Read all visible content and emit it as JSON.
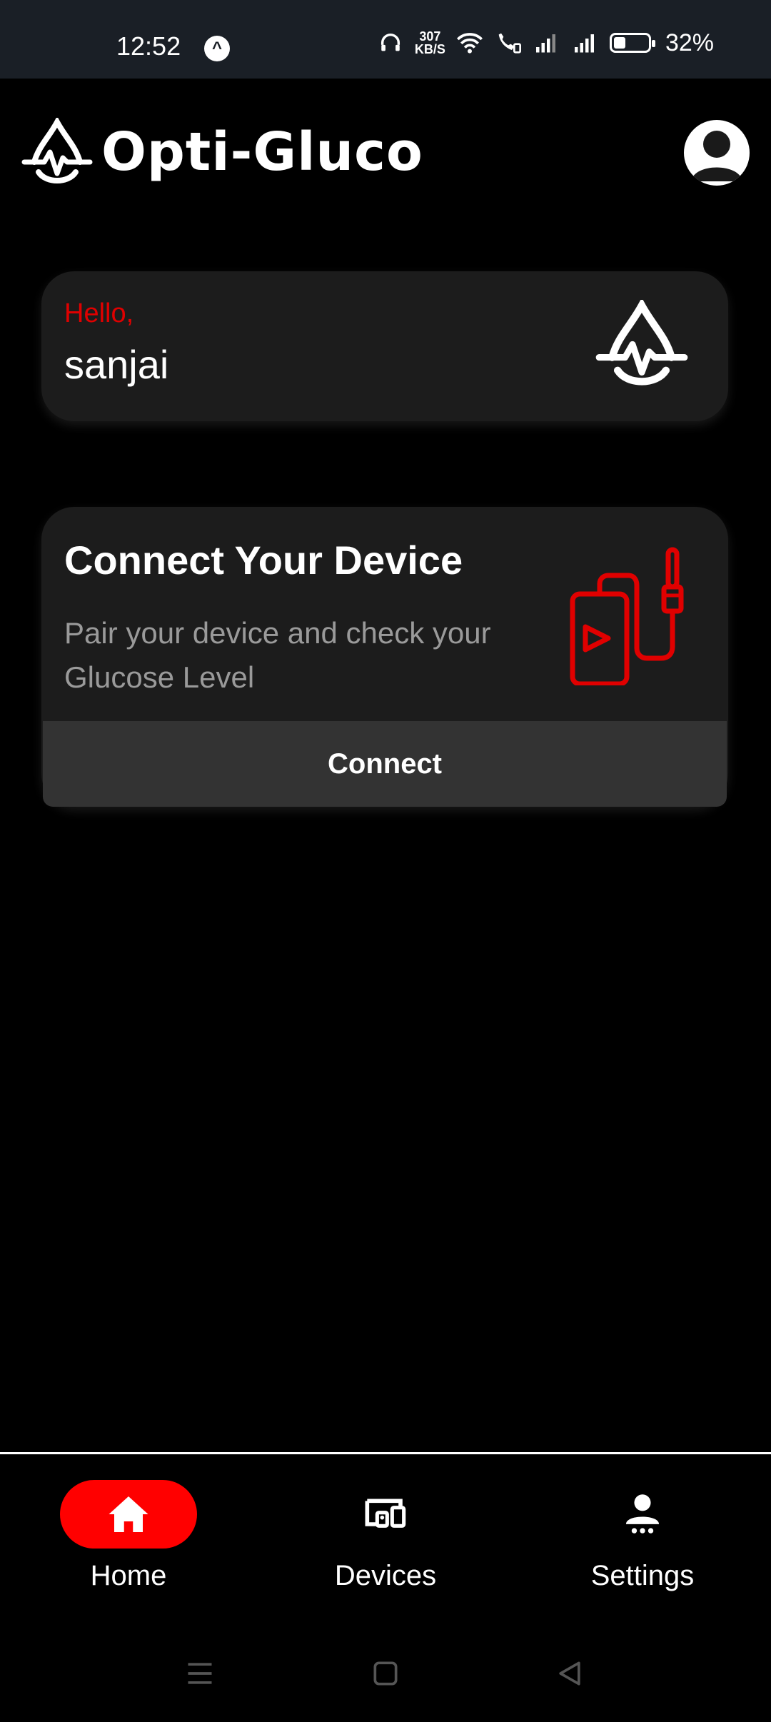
{
  "status_bar": {
    "time": "12:52",
    "network_speed": "307",
    "network_speed_unit": "KB/S",
    "battery_percent": "32%"
  },
  "header": {
    "app_name": "Opti-Gluco",
    "logo_icon": "pulse-drop-logo",
    "avatar_icon": "user-avatar-icon"
  },
  "greeting": {
    "hello": "Hello,",
    "name": "sanjai"
  },
  "connect_card": {
    "title": "Connect Your Device",
    "description": "Pair your device and check your Glucose Level",
    "button_label": "Connect",
    "illustration_icon": "device-cable-icon"
  },
  "bottom_nav": {
    "items": [
      {
        "label": "Home",
        "icon": "home-icon",
        "active": true
      },
      {
        "label": "Devices",
        "icon": "devices-icon",
        "active": false
      },
      {
        "label": "Settings",
        "icon": "person-settings-icon",
        "active": false
      }
    ]
  },
  "colors": {
    "accent": "#ff0000",
    "hello_text": "#e00000",
    "card_bg": "#1c1c1c",
    "button_bg": "#333333"
  }
}
